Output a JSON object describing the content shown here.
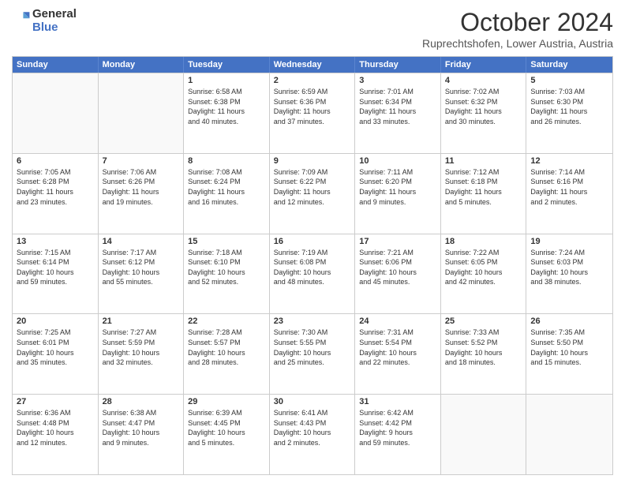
{
  "header": {
    "logo_line1": "General",
    "logo_line2": "Blue",
    "title": "October 2024",
    "subtitle": "Ruprechtshofen, Lower Austria, Austria"
  },
  "days": [
    "Sunday",
    "Monday",
    "Tuesday",
    "Wednesday",
    "Thursday",
    "Friday",
    "Saturday"
  ],
  "rows": [
    [
      {
        "day": "",
        "empty": true
      },
      {
        "day": "",
        "empty": true
      },
      {
        "day": "1",
        "line1": "Sunrise: 6:58 AM",
        "line2": "Sunset: 6:38 PM",
        "line3": "Daylight: 11 hours",
        "line4": "and 40 minutes."
      },
      {
        "day": "2",
        "line1": "Sunrise: 6:59 AM",
        "line2": "Sunset: 6:36 PM",
        "line3": "Daylight: 11 hours",
        "line4": "and 37 minutes."
      },
      {
        "day": "3",
        "line1": "Sunrise: 7:01 AM",
        "line2": "Sunset: 6:34 PM",
        "line3": "Daylight: 11 hours",
        "line4": "and 33 minutes."
      },
      {
        "day": "4",
        "line1": "Sunrise: 7:02 AM",
        "line2": "Sunset: 6:32 PM",
        "line3": "Daylight: 11 hours",
        "line4": "and 30 minutes."
      },
      {
        "day": "5",
        "line1": "Sunrise: 7:03 AM",
        "line2": "Sunset: 6:30 PM",
        "line3": "Daylight: 11 hours",
        "line4": "and 26 minutes."
      }
    ],
    [
      {
        "day": "6",
        "line1": "Sunrise: 7:05 AM",
        "line2": "Sunset: 6:28 PM",
        "line3": "Daylight: 11 hours",
        "line4": "and 23 minutes."
      },
      {
        "day": "7",
        "line1": "Sunrise: 7:06 AM",
        "line2": "Sunset: 6:26 PM",
        "line3": "Daylight: 11 hours",
        "line4": "and 19 minutes."
      },
      {
        "day": "8",
        "line1": "Sunrise: 7:08 AM",
        "line2": "Sunset: 6:24 PM",
        "line3": "Daylight: 11 hours",
        "line4": "and 16 minutes."
      },
      {
        "day": "9",
        "line1": "Sunrise: 7:09 AM",
        "line2": "Sunset: 6:22 PM",
        "line3": "Daylight: 11 hours",
        "line4": "and 12 minutes."
      },
      {
        "day": "10",
        "line1": "Sunrise: 7:11 AM",
        "line2": "Sunset: 6:20 PM",
        "line3": "Daylight: 11 hours",
        "line4": "and 9 minutes."
      },
      {
        "day": "11",
        "line1": "Sunrise: 7:12 AM",
        "line2": "Sunset: 6:18 PM",
        "line3": "Daylight: 11 hours",
        "line4": "and 5 minutes."
      },
      {
        "day": "12",
        "line1": "Sunrise: 7:14 AM",
        "line2": "Sunset: 6:16 PM",
        "line3": "Daylight: 11 hours",
        "line4": "and 2 minutes."
      }
    ],
    [
      {
        "day": "13",
        "line1": "Sunrise: 7:15 AM",
        "line2": "Sunset: 6:14 PM",
        "line3": "Daylight: 10 hours",
        "line4": "and 59 minutes."
      },
      {
        "day": "14",
        "line1": "Sunrise: 7:17 AM",
        "line2": "Sunset: 6:12 PM",
        "line3": "Daylight: 10 hours",
        "line4": "and 55 minutes."
      },
      {
        "day": "15",
        "line1": "Sunrise: 7:18 AM",
        "line2": "Sunset: 6:10 PM",
        "line3": "Daylight: 10 hours",
        "line4": "and 52 minutes."
      },
      {
        "day": "16",
        "line1": "Sunrise: 7:19 AM",
        "line2": "Sunset: 6:08 PM",
        "line3": "Daylight: 10 hours",
        "line4": "and 48 minutes."
      },
      {
        "day": "17",
        "line1": "Sunrise: 7:21 AM",
        "line2": "Sunset: 6:06 PM",
        "line3": "Daylight: 10 hours",
        "line4": "and 45 minutes."
      },
      {
        "day": "18",
        "line1": "Sunrise: 7:22 AM",
        "line2": "Sunset: 6:05 PM",
        "line3": "Daylight: 10 hours",
        "line4": "and 42 minutes."
      },
      {
        "day": "19",
        "line1": "Sunrise: 7:24 AM",
        "line2": "Sunset: 6:03 PM",
        "line3": "Daylight: 10 hours",
        "line4": "and 38 minutes."
      }
    ],
    [
      {
        "day": "20",
        "line1": "Sunrise: 7:25 AM",
        "line2": "Sunset: 6:01 PM",
        "line3": "Daylight: 10 hours",
        "line4": "and 35 minutes."
      },
      {
        "day": "21",
        "line1": "Sunrise: 7:27 AM",
        "line2": "Sunset: 5:59 PM",
        "line3": "Daylight: 10 hours",
        "line4": "and 32 minutes."
      },
      {
        "day": "22",
        "line1": "Sunrise: 7:28 AM",
        "line2": "Sunset: 5:57 PM",
        "line3": "Daylight: 10 hours",
        "line4": "and 28 minutes."
      },
      {
        "day": "23",
        "line1": "Sunrise: 7:30 AM",
        "line2": "Sunset: 5:55 PM",
        "line3": "Daylight: 10 hours",
        "line4": "and 25 minutes."
      },
      {
        "day": "24",
        "line1": "Sunrise: 7:31 AM",
        "line2": "Sunset: 5:54 PM",
        "line3": "Daylight: 10 hours",
        "line4": "and 22 minutes."
      },
      {
        "day": "25",
        "line1": "Sunrise: 7:33 AM",
        "line2": "Sunset: 5:52 PM",
        "line3": "Daylight: 10 hours",
        "line4": "and 18 minutes."
      },
      {
        "day": "26",
        "line1": "Sunrise: 7:35 AM",
        "line2": "Sunset: 5:50 PM",
        "line3": "Daylight: 10 hours",
        "line4": "and 15 minutes."
      }
    ],
    [
      {
        "day": "27",
        "line1": "Sunrise: 6:36 AM",
        "line2": "Sunset: 4:48 PM",
        "line3": "Daylight: 10 hours",
        "line4": "and 12 minutes."
      },
      {
        "day": "28",
        "line1": "Sunrise: 6:38 AM",
        "line2": "Sunset: 4:47 PM",
        "line3": "Daylight: 10 hours",
        "line4": "and 9 minutes."
      },
      {
        "day": "29",
        "line1": "Sunrise: 6:39 AM",
        "line2": "Sunset: 4:45 PM",
        "line3": "Daylight: 10 hours",
        "line4": "and 5 minutes."
      },
      {
        "day": "30",
        "line1": "Sunrise: 6:41 AM",
        "line2": "Sunset: 4:43 PM",
        "line3": "Daylight: 10 hours",
        "line4": "and 2 minutes."
      },
      {
        "day": "31",
        "line1": "Sunrise: 6:42 AM",
        "line2": "Sunset: 4:42 PM",
        "line3": "Daylight: 9 hours",
        "line4": "and 59 minutes."
      },
      {
        "day": "",
        "empty": true
      },
      {
        "day": "",
        "empty": true
      }
    ]
  ]
}
